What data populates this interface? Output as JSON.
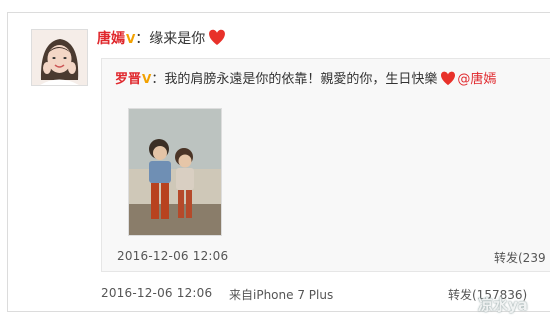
{
  "post": {
    "author": "唐嫣",
    "colon": "：",
    "text": "缘来是你"
  },
  "repost": {
    "author": "罗晋",
    "colon": "：",
    "text": "我的肩膀永遠是你的依靠！親愛的你，生日快樂",
    "mention": "@唐嫣",
    "time": "2016-12-06 12:06",
    "forward": "转发(239"
  },
  "footer": {
    "time": "2016-12-06 12:06",
    "source": "来自iPhone 7 Plus",
    "forward": "转发(157836)"
  },
  "watermark": "凉水ya",
  "colors": {
    "accent": "#e0282d",
    "badge": "#f2a100",
    "heart": "#e8312a"
  }
}
